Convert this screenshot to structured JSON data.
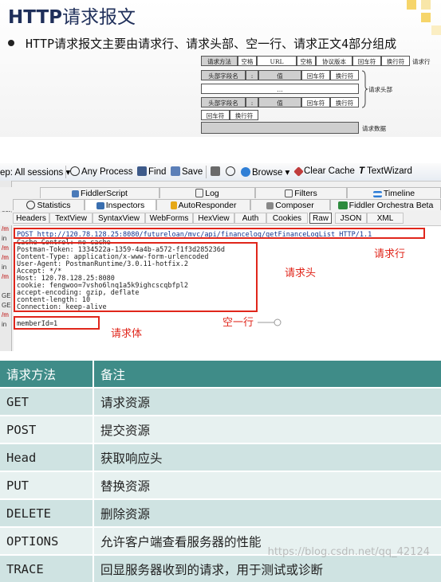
{
  "slide": {
    "title_en": "HTTP",
    "title_cn": "请求报文",
    "bullet": "HTTP请求报文主要由请求行、请求头部、空一行、请求正文4部分组成"
  },
  "diagram": {
    "row1": [
      "请求方法",
      "空格",
      "URL",
      "空格",
      "协议版本",
      "回车符",
      "换行符"
    ],
    "row1_label": "请求行",
    "row2": [
      "头部字段名",
      ":",
      "值",
      "回车符",
      "换行符"
    ],
    "row3": "…",
    "row4": [
      "头部字段名",
      ":",
      "值",
      "回车符",
      "换行符"
    ],
    "header_label": "请求头部",
    "row5": [
      "回车符",
      "换行符"
    ],
    "body_label": "请求数据"
  },
  "fiddler": {
    "toolbar": {
      "sessions": "ep: All sessions ▾",
      "any_process": "Any Process",
      "find": "Find",
      "save": "Save",
      "browse": "Browse ▾",
      "clear_cache": "Clear Cache",
      "textwizard": "TextWizard"
    },
    "tabs_row1": [
      "FiddlerScript",
      "Log",
      "Filters",
      "Timeline"
    ],
    "tabs_row2": [
      "Statistics",
      "Inspectors",
      "AutoResponder",
      "Composer",
      "Fiddler Orchestra Beta"
    ],
    "subtabs": [
      "Headers",
      "TextView",
      "SyntaxView",
      "WebForms",
      "HexView",
      "Auth",
      "Cookies",
      "Raw",
      "JSON",
      "XML"
    ],
    "left_strip": [
      "ect",
      "/m",
      "in",
      "/m",
      "/m",
      "in",
      "/m",
      "GE",
      "GE",
      "/m",
      "in"
    ],
    "raw_lines": [
      "POST http://120.78.128.25:8080/futureloan/mvc/api/financelog/getFinanceLogList HTTP/1.1",
      "Cache-Control: no-cache",
      "Postman-Token: 1334522a-1359-4a4b-a572-f1f3d285236d",
      "Content-Type: application/x-www-form-urlencoded",
      "User-Agent: PostmanRuntime/3.0.11-hotfix.2",
      "Accept: */*",
      "Host: 120.78.128.25:8080",
      "cookie: fengwoo=7vsho6lnq1a5k9ighcscqbfpl2",
      "accept-encoding: gzip, deflate",
      "content-length: 10",
      "Connection: keep-alive",
      "",
      "memberId=1"
    ],
    "annotations": {
      "request_line": "请求行",
      "request_header": "请求头",
      "blank_line": "空一行",
      "request_body": "请求体"
    }
  },
  "table": {
    "headers": [
      "请求方法",
      "备注"
    ],
    "rows": [
      [
        "GET",
        "请求资源"
      ],
      [
        "POST",
        "提交资源"
      ],
      [
        "Head",
        "获取响应头"
      ],
      [
        "PUT",
        "替换资源"
      ],
      [
        "DELETE",
        "删除资源"
      ],
      [
        "OPTIONS",
        "允许客户端查看服务器的性能"
      ],
      [
        "TRACE",
        "回显服务器收到的请求，用于测试或诊断"
      ]
    ]
  },
  "watermark": "https://blog.csdn.net/qq_42124"
}
